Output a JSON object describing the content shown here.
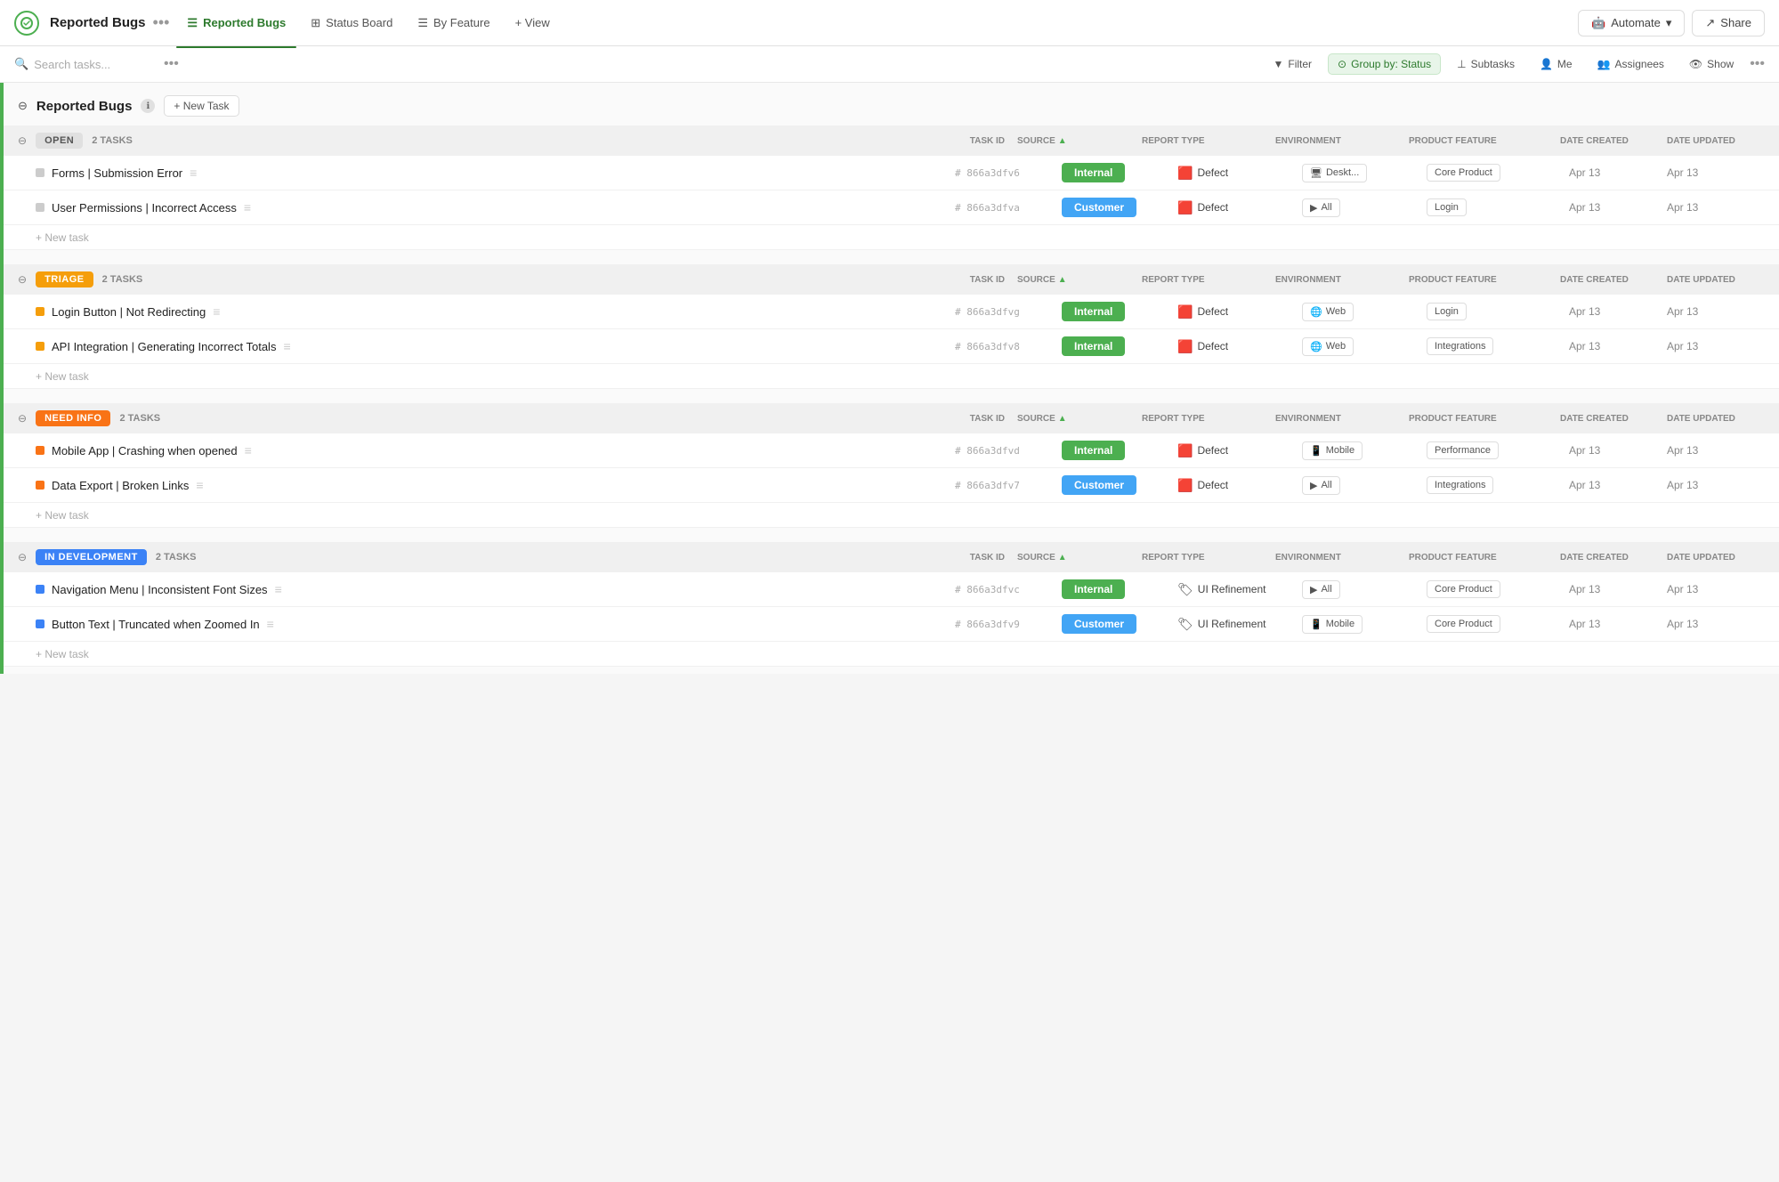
{
  "app": {
    "logo_letter": "●",
    "title": "Reported Bugs",
    "dots": "•••"
  },
  "nav": {
    "tabs": [
      {
        "id": "reported-bugs",
        "icon": "☰",
        "label": "Reported Bugs",
        "active": true
      },
      {
        "id": "status-board",
        "icon": "⊞",
        "label": "Status Board",
        "active": false
      },
      {
        "id": "by-feature",
        "icon": "☰",
        "label": "By Feature",
        "active": false
      }
    ],
    "view_btn": "+ View",
    "automate_label": "Automate",
    "share_label": "Share"
  },
  "toolbar": {
    "search_placeholder": "Search tasks...",
    "dots": "•••",
    "filter_label": "Filter",
    "group_label": "Group by: Status",
    "subtasks_label": "Subtasks",
    "me_label": "Me",
    "assignees_label": "Assignees",
    "show_label": "Show",
    "more_dots": "•••"
  },
  "list": {
    "title": "Reported Bugs",
    "new_task_btn": "+ New Task",
    "groups": [
      {
        "id": "open",
        "status": "OPEN",
        "status_class": "status-open",
        "count": "2 TASKS",
        "columns": [
          "TASK ID",
          "SOURCE",
          "REPORT TYPE",
          "ENVIRONMENT",
          "PRODUCT FEATURE",
          "DATE CREATED",
          "DATE UPDATED"
        ],
        "tasks": [
          {
            "name": "Forms | Submission Error",
            "dot_class": "dot-gray",
            "id": "# 866a3dfv6",
            "source": "Internal",
            "source_class": "source-internal",
            "report_type": "Defect",
            "environment": "Deskt...",
            "env_icon": "🖥",
            "feature": "Core Product",
            "date_created": "Apr 13",
            "date_updated": "Apr 13"
          },
          {
            "name": "User Permissions | Incorrect Access",
            "dot_class": "dot-gray",
            "id": "# 866a3dfva",
            "source": "Customer",
            "source_class": "source-customer",
            "report_type": "Defect",
            "environment": "All",
            "env_icon": "▶",
            "feature": "Login",
            "date_created": "Apr 13",
            "date_updated": "Apr 13"
          }
        ]
      },
      {
        "id": "triage",
        "status": "TRIAGE",
        "status_class": "status-triage",
        "count": "2 TASKS",
        "columns": [
          "TASK ID",
          "SOURCE",
          "REPORT TYPE",
          "ENVIRONMENT",
          "PRODUCT FEATURE",
          "DATE CREATED",
          "DATE UPDATED"
        ],
        "tasks": [
          {
            "name": "Login Button | Not Redirecting",
            "dot_class": "dot-yellow",
            "id": "# 866a3dfvg",
            "source": "Internal",
            "source_class": "source-internal",
            "report_type": "Defect",
            "environment": "Web",
            "env_icon": "🌐",
            "feature": "Login",
            "date_created": "Apr 13",
            "date_updated": "Apr 13"
          },
          {
            "name": "API Integration | Generating Incorrect Totals",
            "dot_class": "dot-yellow",
            "id": "# 866a3dfv8",
            "source": "Internal",
            "source_class": "source-internal",
            "report_type": "Defect",
            "environment": "Web",
            "env_icon": "🌐",
            "feature": "Integrations",
            "date_created": "Apr 13",
            "date_updated": "Apr 13"
          }
        ]
      },
      {
        "id": "need-info",
        "status": "NEED INFO",
        "status_class": "status-need-info",
        "count": "2 TASKS",
        "columns": [
          "TASK ID",
          "SOURCE",
          "REPORT TYPE",
          "ENVIRONMENT",
          "PRODUCT FEATURE",
          "DATE CREATED",
          "DATE UPDATED"
        ],
        "tasks": [
          {
            "name": "Mobile App | Crashing when opened",
            "dot_class": "dot-orange",
            "id": "# 866a3dfvd",
            "source": "Internal",
            "source_class": "source-internal",
            "report_type": "Defect",
            "environment": "Mobile",
            "env_icon": "📱",
            "feature": "Performance",
            "date_created": "Apr 13",
            "date_updated": "Apr 13"
          },
          {
            "name": "Data Export | Broken Links",
            "dot_class": "dot-orange",
            "id": "# 866a3dfv7",
            "source": "Customer",
            "source_class": "source-customer",
            "report_type": "Defect",
            "environment": "All",
            "env_icon": "▶",
            "feature": "Integrations",
            "date_created": "Apr 13",
            "date_updated": "Apr 13"
          }
        ]
      },
      {
        "id": "in-development",
        "status": "IN DEVELOPMENT",
        "status_class": "status-in-development",
        "count": "2 TASKS",
        "columns": [
          "TASK ID",
          "SOURCE",
          "REPORT TYPE",
          "ENVIRONMENT",
          "PRODUCT FEATURE",
          "DATE CREATED",
          "DATE UPDATED"
        ],
        "tasks": [
          {
            "name": "Navigation Menu | Inconsistent Font Sizes",
            "dot_class": "dot-blue",
            "id": "# 866a3dfvc",
            "source": "Internal",
            "source_class": "source-internal",
            "report_type": "UI Refinement",
            "report_icon": "🏷",
            "environment": "All",
            "env_icon": "▶",
            "feature": "Core Product",
            "date_created": "Apr 13",
            "date_updated": "Apr 13"
          },
          {
            "name": "Button Text | Truncated when Zoomed In",
            "dot_class": "dot-blue",
            "id": "# 866a3dfv9",
            "source": "Customer",
            "source_class": "source-customer",
            "report_type": "UI Refinement",
            "report_icon": "🏷",
            "environment": "Mobile",
            "env_icon": "📱",
            "feature": "Core Product",
            "date_created": "Apr 13",
            "date_updated": "Apr 13"
          }
        ]
      }
    ]
  }
}
